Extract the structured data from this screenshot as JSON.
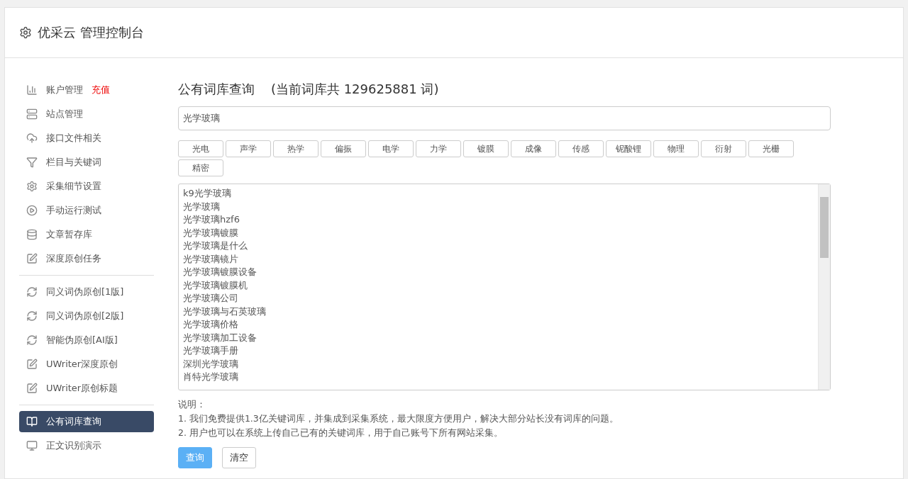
{
  "header": {
    "title": "优采云 管理控制台"
  },
  "sidebar": {
    "groups": [
      {
        "items": [
          {
            "label": "账户管理",
            "badge": "充值",
            "kind": "chart",
            "selected": false
          },
          {
            "label": "站点管理",
            "kind": "server",
            "selected": false
          },
          {
            "label": "接口文件相关",
            "kind": "cloud",
            "selected": false
          },
          {
            "label": "栏目与关键词",
            "kind": "filter",
            "selected": false
          },
          {
            "label": "采集细节设置",
            "kind": "gears",
            "selected": false
          },
          {
            "label": "手动运行测试",
            "kind": "play",
            "selected": false
          },
          {
            "label": "文章暂存库",
            "kind": "database",
            "selected": false
          },
          {
            "label": "深度原创任务",
            "kind": "edit",
            "selected": false
          }
        ]
      },
      {
        "items": [
          {
            "label": "同义词伪原创[1版]",
            "kind": "refresh",
            "selected": false
          },
          {
            "label": "同义词伪原创[2版]",
            "kind": "refresh",
            "selected": false
          },
          {
            "label": "智能伪原创[AI版]",
            "kind": "refresh",
            "selected": false
          },
          {
            "label": "UWriter深度原创",
            "kind": "edit",
            "selected": false
          },
          {
            "label": "UWriter原创标题",
            "kind": "edit",
            "selected": false
          }
        ]
      },
      {
        "items": [
          {
            "label": "公有词库查询",
            "kind": "book",
            "selected": true
          },
          {
            "label": "正文识别演示",
            "kind": "monitor",
            "selected": false
          }
        ]
      }
    ]
  },
  "main": {
    "title": "公有词库查询",
    "count_text": "(当前词库共 129625881 词)",
    "search": {
      "value": "光学玻璃"
    },
    "tags": [
      "光电",
      "声学",
      "热学",
      "偏振",
      "电学",
      "力学",
      "镀膜",
      "成像",
      "传感",
      "铌酸锂",
      "物理",
      "衍射",
      "光栅",
      "精密"
    ],
    "results": [
      "k9光学玻璃",
      "光学玻璃",
      "光学玻璃hzf6",
      "光学玻璃镀膜",
      "光学玻璃是什么",
      "光学玻璃镜片",
      "光学玻璃镀膜设备",
      "光学玻璃镀膜机",
      "光学玻璃公司",
      "光学玻璃与石英玻璃",
      "光学玻璃价格",
      "光学玻璃加工设备",
      "光学玻璃手册",
      "深圳光学玻璃",
      "肖特光学玻璃"
    ],
    "notes_title": "说明：",
    "notes": [
      "1. 我们免费提供1.3亿关键词库，并集成到采集系统，最大限度方便用户，解决大部分站长没有词库的问题。",
      "2. 用户也可以在系统上传自己已有的关键词库，用于自己账号下所有网站采集。"
    ],
    "buttons": [
      {
        "label": "查询",
        "kind": "primary"
      },
      {
        "label": "清空",
        "kind": "default"
      }
    ]
  }
}
